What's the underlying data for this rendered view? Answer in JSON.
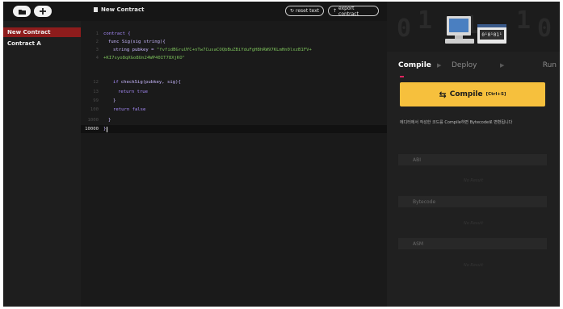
{
  "topbar": {
    "file_name": "New Contract",
    "reset_label": "reset text",
    "export_label": "export contract"
  },
  "sidebar": {
    "items": [
      {
        "label": "New Contract",
        "active": true
      },
      {
        "label": "Contract A",
        "active": false
      }
    ]
  },
  "editor": {
    "lines": [
      {
        "num": "1",
        "text": "contract {"
      },
      {
        "num": "2",
        "text": "func Sig(sig string){"
      },
      {
        "num": "3",
        "prefix": "string pubkey = ",
        "str": "\"fvfidBGruUYC+nTw7CusaCOQbBuZBiYduFgH8hRW97KLmHn0lxzB1FV+"
      },
      {
        "num": "4",
        "str": "+KI7syo8qXGo8Un24WP40IT78XjKO\""
      },
      {
        "num": "12",
        "kw": "if",
        "text": "checkSig(pubkey, sig){"
      },
      {
        "num": "13",
        "kw": "return true"
      },
      {
        "num": "99",
        "text": "}"
      },
      {
        "num": "100",
        "kw": "return false"
      },
      {
        "num": "1000",
        "text": "}"
      },
      {
        "num": "10000",
        "text": "}"
      }
    ]
  },
  "panel": {
    "banner_digits": [
      "0",
      "1",
      "1",
      "1",
      "0"
    ],
    "binary_text": "0¹0¹01¹",
    "tabs": [
      "Compile",
      "Deploy",
      "Run"
    ],
    "active_tab": "Compile",
    "compile_label": "Compile",
    "compile_shortcut": "[Ctrl+S]",
    "hint": "에디터에서 작성한 코드를 Compile하면 Bytecode로 변환됩니다",
    "outputs": [
      {
        "label": "ABI",
        "empty": "No Result"
      },
      {
        "label": "Bytecode",
        "empty": "No Result"
      },
      {
        "label": "ASM",
        "empty": "No Result"
      }
    ]
  },
  "colors": {
    "accent_yellow": "#f6c03d",
    "sidebar_active": "#8e1c1c",
    "tab_underline": "#e0245e",
    "string": "#7cc05b",
    "keyword": "#a78bfa"
  }
}
